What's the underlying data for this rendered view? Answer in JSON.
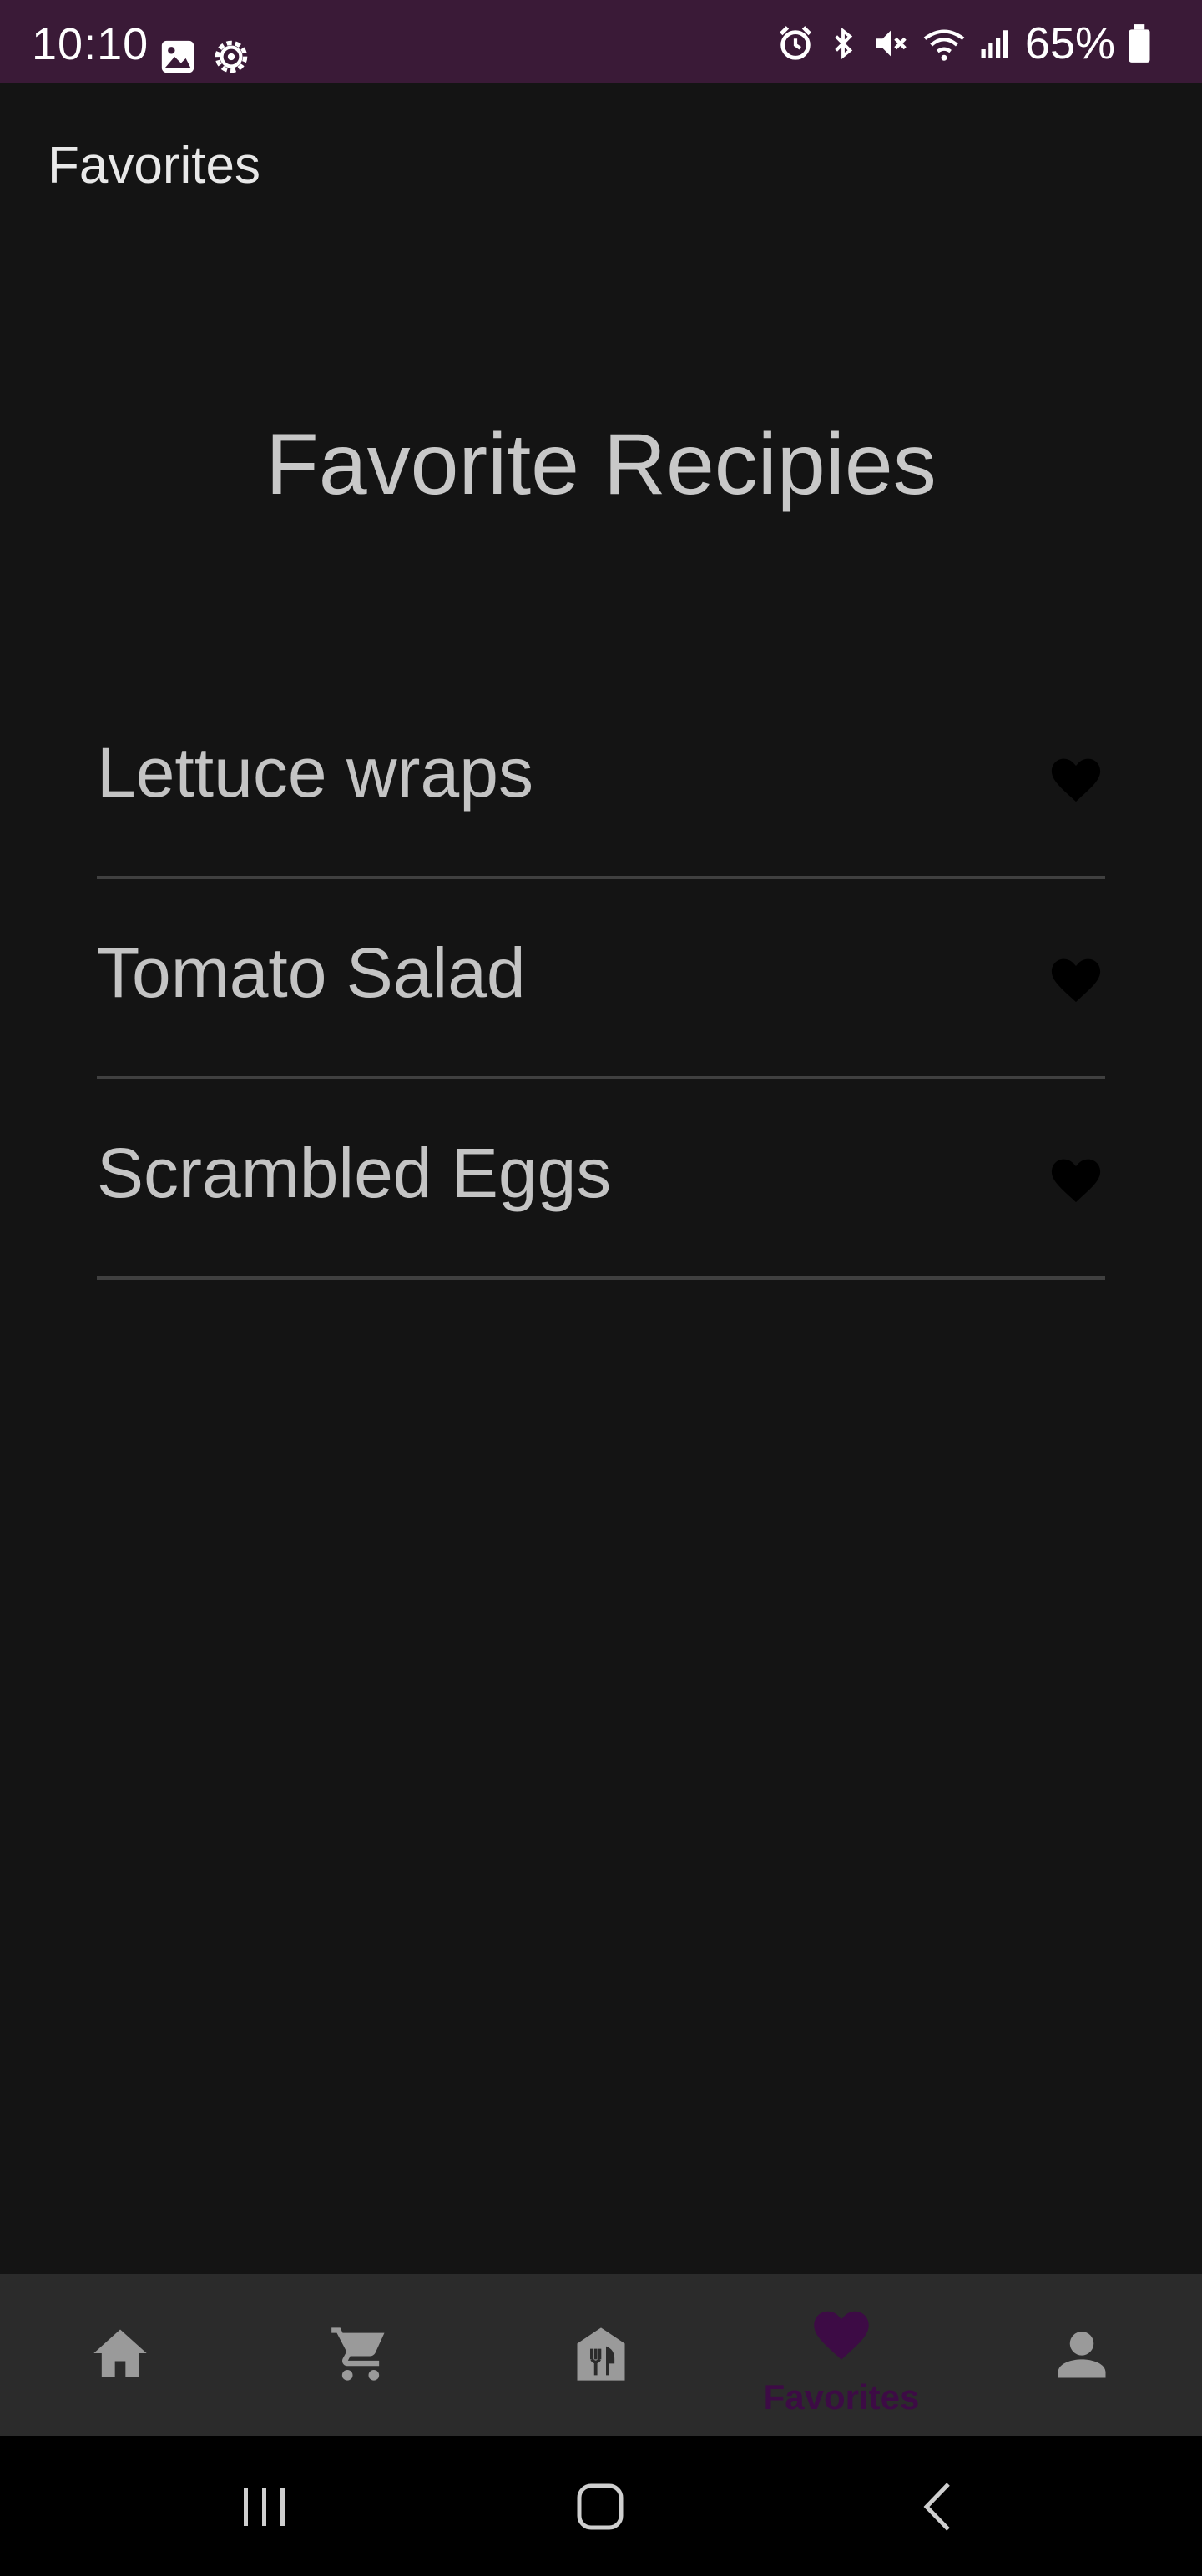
{
  "status_bar": {
    "time": "10:10",
    "battery": "65%",
    "background": "#3a1a37",
    "left_icons": [
      "image-icon",
      "gear-icon"
    ],
    "right_icons": [
      "alarm-icon",
      "bluetooth-icon",
      "mute-icon",
      "wifi-icon",
      "signal-icon",
      "battery-icon"
    ]
  },
  "app_bar": {
    "title": "Favorites"
  },
  "page": {
    "heading": "Favorite Recipies"
  },
  "favorites": [
    {
      "name": "Lettuce wraps",
      "icon": "heart-icon"
    },
    {
      "name": "Tomato Salad",
      "icon": "heart-icon"
    },
    {
      "name": "Scrambled Eggs",
      "icon": "heart-icon"
    }
  ],
  "bottom_nav": {
    "active_color": "#3d0b45",
    "items": [
      {
        "icon": "home-icon",
        "label": ""
      },
      {
        "icon": "cart-icon",
        "label": ""
      },
      {
        "icon": "restaurant-icon",
        "label": ""
      },
      {
        "icon": "heart-icon",
        "label": "Favorites",
        "active": true
      },
      {
        "icon": "person-icon",
        "label": ""
      }
    ]
  },
  "system_nav": {
    "buttons": [
      "recents-icon",
      "home-button-icon",
      "back-icon"
    ]
  }
}
